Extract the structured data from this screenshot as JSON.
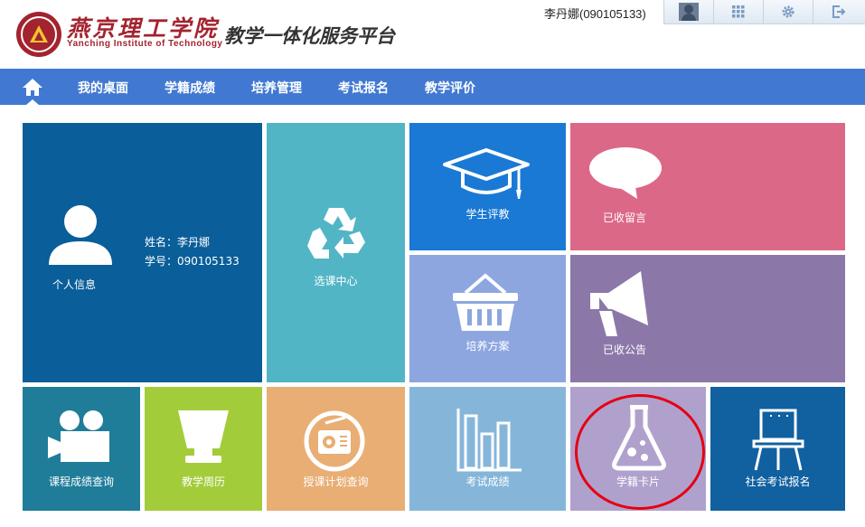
{
  "header": {
    "school_name_cn": "燕京理工学院",
    "school_name_en": "Yanching Institute of Technology",
    "platform_title": "教学一体化服务平台",
    "user_display": "李丹娜(090105133)"
  },
  "toolbar": {
    "items": [
      "avatar",
      "apps-grid-icon",
      "gear-icon",
      "logout-icon"
    ]
  },
  "nav": {
    "items": [
      "我的桌面",
      "学籍成绩",
      "培养管理",
      "考试报名",
      "教学评价"
    ]
  },
  "tiles": {
    "personal_info": {
      "label": "个人信息",
      "name_line": "姓名：李丹娜",
      "id_line": "学号：090105133",
      "color": "#0a5e99"
    },
    "course_selection": {
      "label": "选课中心",
      "color": "#52b5c6"
    },
    "student_eval": {
      "label": "学生评教",
      "color": "#1a79d4"
    },
    "received_messages": {
      "label": "已收留言",
      "color": "#dc6887"
    },
    "training_plan": {
      "label": "培养方案",
      "color": "#8da6e0"
    },
    "received_notices": {
      "label": "已收公告",
      "color": "#8b78a8"
    },
    "course_grade_query": {
      "label": "课程成绩查询",
      "color": "#1f7d99"
    },
    "teaching_calendar": {
      "label": "教学周历",
      "color": "#a3cc3a"
    },
    "teaching_plan_query": {
      "label": "授课计划查询",
      "color": "#e8ae74"
    },
    "exam_grades": {
      "label": "考试成绩",
      "color": "#85b6da"
    },
    "student_card": {
      "label": "学籍卡片",
      "color": "#b0a1cc"
    },
    "social_exam_signup": {
      "label": "社会考试报名",
      "color": "#1160a0"
    }
  },
  "accent": {
    "highlight_ring": "#e60012",
    "nav_bg": "#4179d2"
  }
}
